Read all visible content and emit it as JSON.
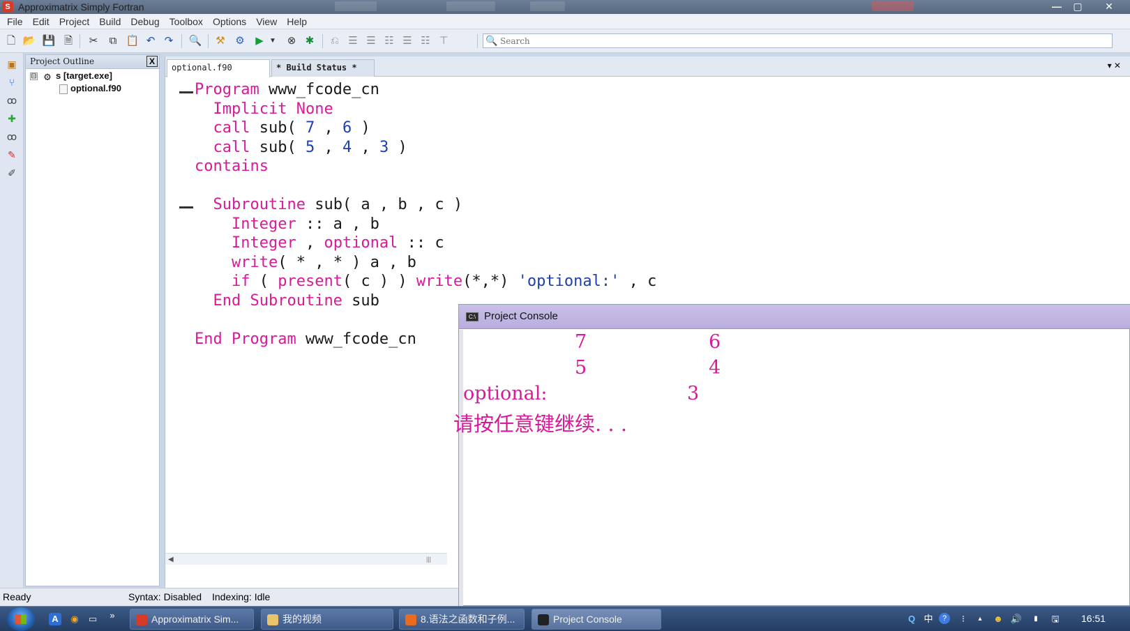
{
  "window": {
    "title": "Approximatrix Simply Fortran",
    "controls": [
      "—",
      "▢",
      "✕"
    ]
  },
  "menu": [
    "File",
    "Edit",
    "Project",
    "Build",
    "Debug",
    "Toolbox",
    "Options",
    "View",
    "Help"
  ],
  "toolbar": {
    "icons": [
      "new-file-icon",
      "open-folder-icon",
      "save-icon",
      "close-file-icon",
      "cut-icon",
      "copy-icon",
      "paste-icon",
      "undo-icon",
      "redo-icon",
      "find-icon",
      "build-icon",
      "settings-gear-icon",
      "run-icon",
      "dropdown-arrow-icon",
      "debug-icon",
      "clean-icon",
      "indent-icon",
      "outdent-icon",
      "align-left-icon",
      "align-center-icon",
      "align-right-icon",
      "align-top-icon",
      "align-bottom-icon"
    ],
    "search_placeholder": "Search"
  },
  "outline": {
    "title": "Project Outline",
    "close": "X",
    "tree": [
      {
        "toggle": "⊟",
        "label": "s [target.exe]"
      },
      {
        "label": "optional.f90"
      }
    ]
  },
  "tabs": [
    {
      "label": "optional.f90",
      "active": true
    },
    {
      "label": "* Build Status *",
      "active": false
    }
  ],
  "tab_controls": "▾  ✕",
  "code": [
    {
      "segs": [
        [
          "kw",
          "Program"
        ],
        [
          "p",
          " www_fcode_cn"
        ]
      ]
    },
    {
      "segs": [
        [
          "p",
          "  "
        ],
        [
          "kw",
          "Implicit None"
        ]
      ]
    },
    {
      "segs": [
        [
          "p",
          "  "
        ],
        [
          "kw",
          "call"
        ],
        [
          "p",
          " sub( "
        ],
        [
          "num",
          "7"
        ],
        [
          "p",
          " , "
        ],
        [
          "num",
          "6"
        ],
        [
          "p",
          " )"
        ]
      ]
    },
    {
      "segs": [
        [
          "p",
          "  "
        ],
        [
          "kw",
          "call"
        ],
        [
          "p",
          " sub( "
        ],
        [
          "num",
          "5"
        ],
        [
          "p",
          " , "
        ],
        [
          "num",
          "4"
        ],
        [
          "p",
          " , "
        ],
        [
          "num",
          "3"
        ],
        [
          "p",
          " )"
        ]
      ]
    },
    {
      "segs": [
        [
          "kw",
          "contains"
        ]
      ]
    },
    {
      "segs": [
        [
          "p",
          ""
        ]
      ]
    },
    {
      "segs": [
        [
          "p",
          "  "
        ],
        [
          "kw",
          "Subroutine"
        ],
        [
          "p",
          " sub( a , b , c )"
        ]
      ]
    },
    {
      "segs": [
        [
          "p",
          "    "
        ],
        [
          "kw",
          "Integer"
        ],
        [
          "p",
          " :: a , b"
        ]
      ]
    },
    {
      "segs": [
        [
          "p",
          "    "
        ],
        [
          "kw",
          "Integer"
        ],
        [
          "p",
          " , "
        ],
        [
          "kw",
          "optional"
        ],
        [
          "p",
          " :: c"
        ]
      ]
    },
    {
      "segs": [
        [
          "p",
          "    "
        ],
        [
          "kw",
          "write"
        ],
        [
          "p",
          "( * , * ) a , b"
        ]
      ]
    },
    {
      "segs": [
        [
          "p",
          "    "
        ],
        [
          "kw",
          "if"
        ],
        [
          "p",
          " ( "
        ],
        [
          "kw",
          "present"
        ],
        [
          "p",
          "( c ) ) "
        ],
        [
          "kw",
          "write"
        ],
        [
          "p",
          "(*,*) "
        ],
        [
          "str",
          "'optional:'"
        ],
        [
          "p",
          " , c"
        ]
      ]
    },
    {
      "segs": [
        [
          "p",
          "  "
        ],
        [
          "kw",
          "End Subroutine"
        ],
        [
          "p",
          " sub"
        ]
      ]
    },
    {
      "segs": [
        [
          "p",
          ""
        ]
      ]
    },
    {
      "segs": [
        [
          "kw",
          "End Program"
        ],
        [
          "p",
          " www_fcode_cn"
        ]
      ]
    }
  ],
  "console": {
    "title": "Project Console",
    "lines": [
      {
        "a": "7",
        "b": "6"
      },
      {
        "a": "5",
        "b": "4"
      }
    ],
    "optional_label": "optional:",
    "optional_value": "3",
    "prompt": "请按任意键继续. . ."
  },
  "status": {
    "state": "Ready",
    "syntax": "Syntax: Disabled",
    "indexing": "Indexing: Idle"
  },
  "taskbar": {
    "quick_launch": [
      "A",
      "◉",
      "▭",
      "»"
    ],
    "tasks": [
      {
        "label": "Approximatrix Sim...",
        "color": "#d63b2a"
      },
      {
        "label": "我的视频",
        "color": "#e9c46a"
      },
      {
        "label": "8.语法之函数和子例...",
        "color": "#e86b1f"
      },
      {
        "label": "Project Console",
        "color": "#222222"
      }
    ],
    "tray": [
      "Q",
      "中",
      "?",
      "⁝",
      "▴",
      "☻",
      "🔊",
      "▮",
      "🖫"
    ],
    "time": "16:51"
  },
  "colors": {
    "keyword": "#d8199a",
    "number": "#1f3fb0",
    "console_text": "#d8199a"
  }
}
